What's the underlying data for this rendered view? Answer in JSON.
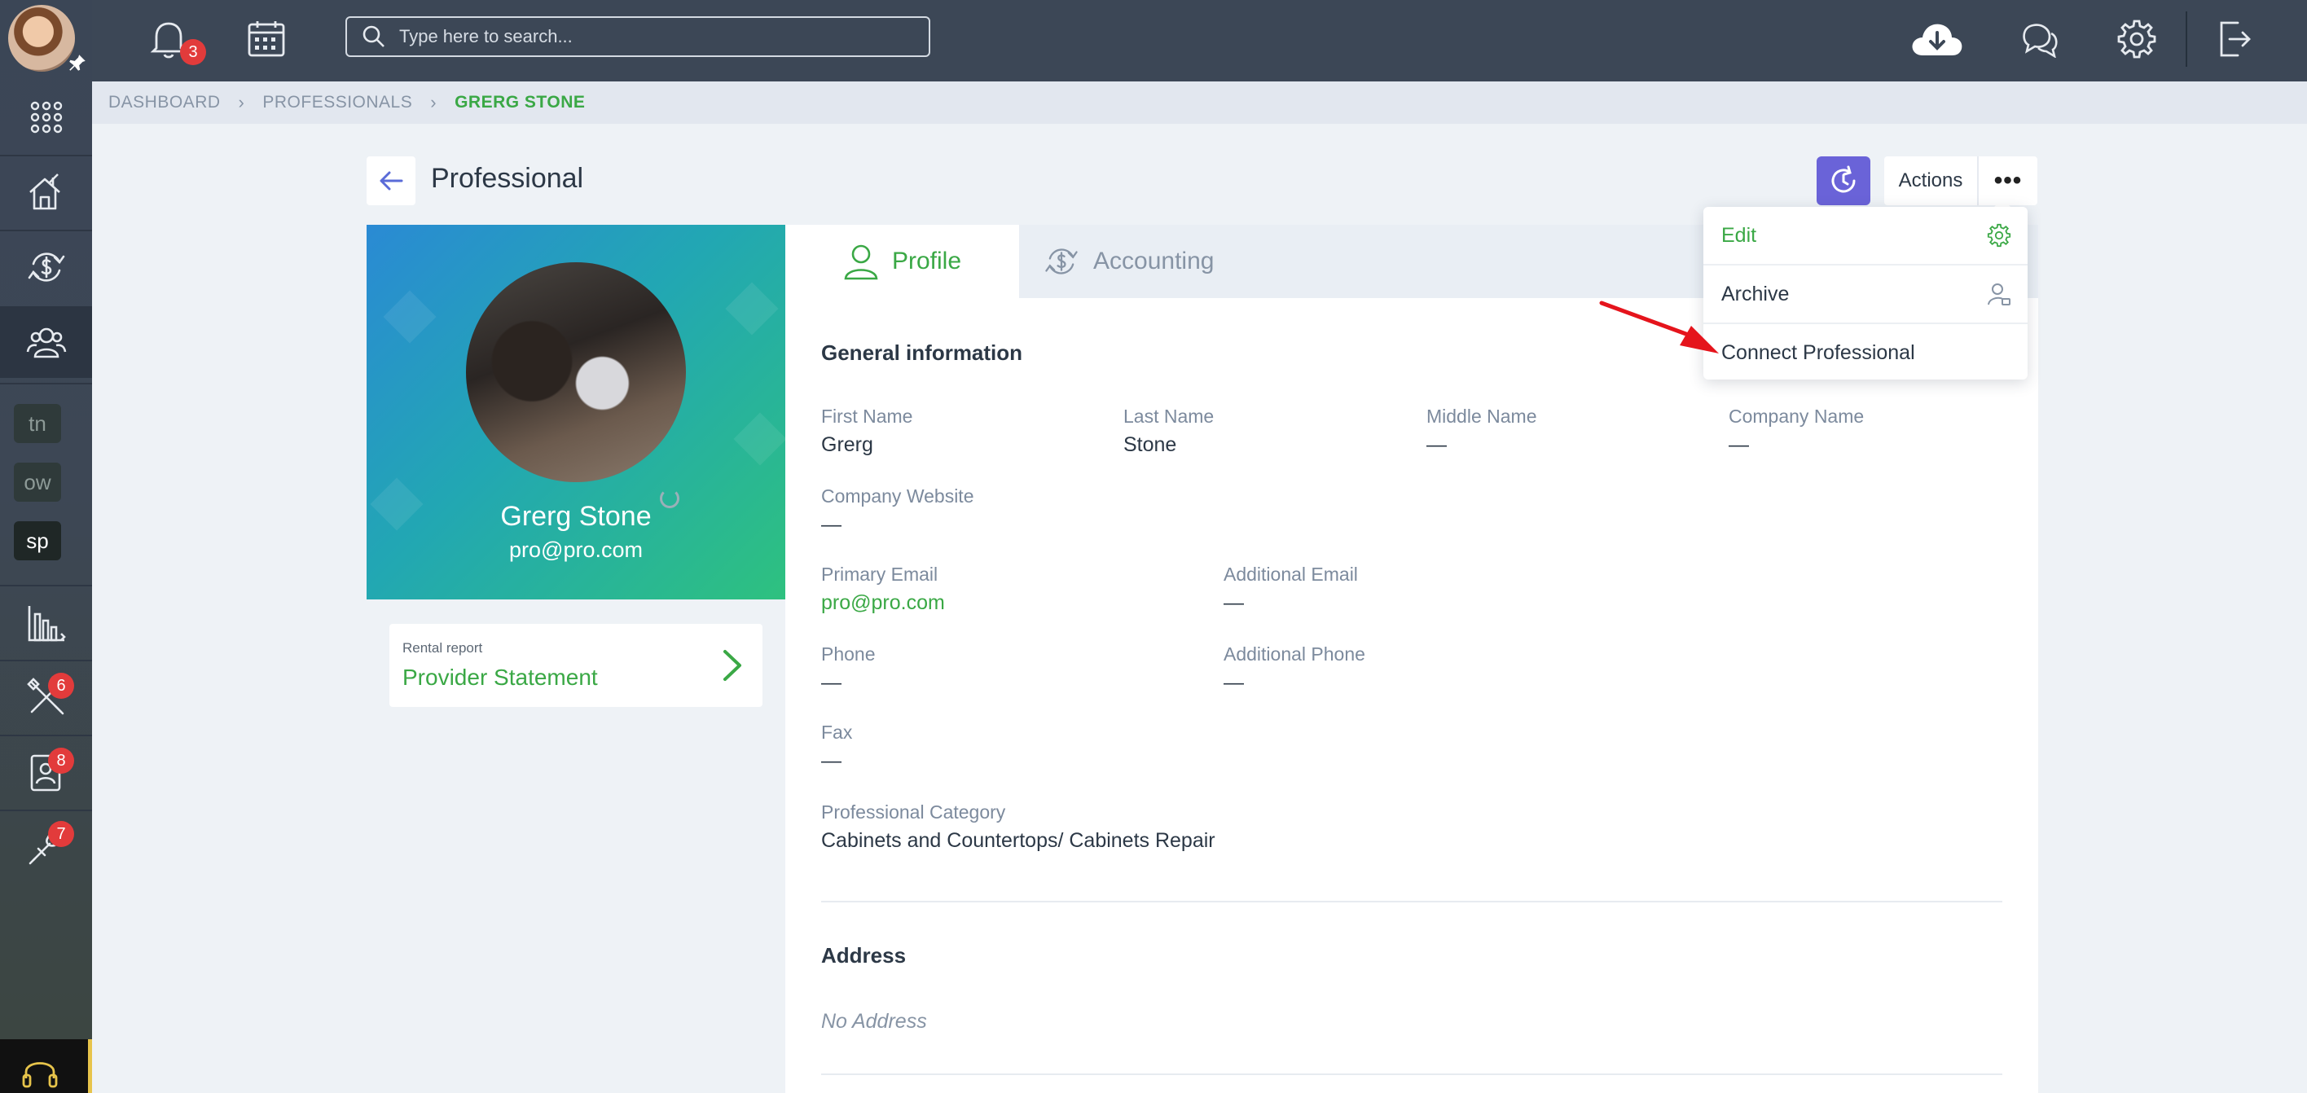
{
  "topbar": {
    "search_placeholder": "Type here to search...",
    "notifications_count": "3"
  },
  "sidebar": {
    "shortcuts": [
      "tn",
      "ow",
      "sp"
    ],
    "badges": {
      "tools": "6",
      "contacts": "8",
      "maintenance": "7"
    }
  },
  "breadcrumb": [
    "DASHBOARD",
    "PROFESSIONALS",
    "GRERG STONE"
  ],
  "header": {
    "title": "Professional",
    "actions_label": "Actions",
    "more_label": "•••"
  },
  "dropdown": {
    "items": [
      "Edit",
      "Archive",
      "Connect Professional"
    ]
  },
  "profile": {
    "name": "Grerg Stone",
    "email": "pro@pro.com"
  },
  "report": {
    "small": "Rental report",
    "title": "Provider Statement"
  },
  "tabs": [
    "Profile",
    "Accounting"
  ],
  "general": {
    "title": "General information",
    "first_name_label": "First Name",
    "first_name": "Grerg",
    "last_name_label": "Last Name",
    "last_name": "Stone",
    "middle_name_label": "Middle Name",
    "middle_name": "—",
    "company_name_label": "Company Name",
    "company_name": "—",
    "company_website_label": "Company Website",
    "company_website": "—",
    "primary_email_label": "Primary Email",
    "primary_email": "pro@pro.com",
    "additional_email_label": "Additional Email",
    "additional_email": "—",
    "phone_label": "Phone",
    "phone": "—",
    "additional_phone_label": "Additional Phone",
    "additional_phone": "—",
    "fax_label": "Fax",
    "fax": "—",
    "category_label": "Professional Category",
    "category": "Cabinets and Countertops/ Cabinets Repair"
  },
  "address": {
    "title": "Address",
    "empty": "No Address"
  },
  "colors": {
    "accent_green": "#3aa845",
    "accent_purple": "#6a63d8",
    "badge_red": "#e23b3b",
    "topbar": "#3c4756"
  }
}
